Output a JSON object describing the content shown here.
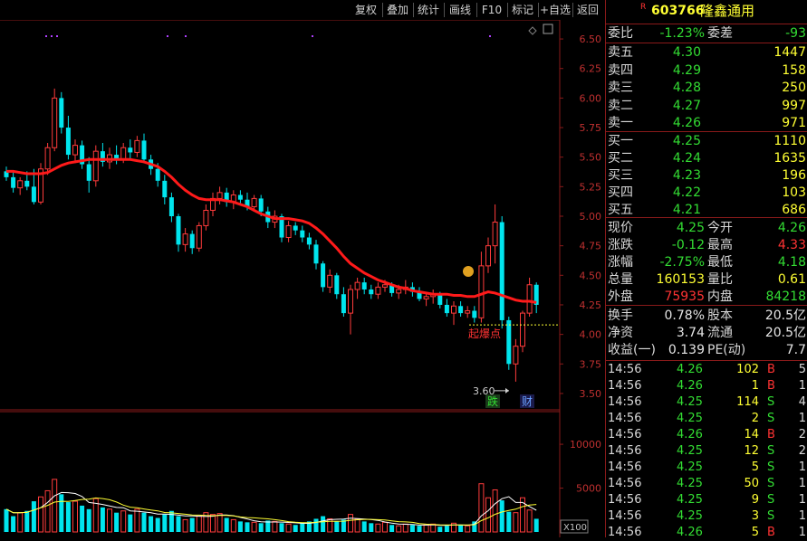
{
  "toolbar": {
    "buttons": [
      "复权",
      "叠加",
      "统计",
      "画线",
      "F10",
      "标记",
      "+自选",
      "返回"
    ]
  },
  "stock": {
    "marker": "R",
    "code": "603766",
    "name": "隆鑫通用"
  },
  "quote_summary": [
    {
      "label": "委比",
      "value": "-1.23%",
      "label2": "委差",
      "value2": "-93"
    }
  ],
  "sell_orders": [
    {
      "label": "卖五",
      "price": "4.30",
      "volume": "1447"
    },
    {
      "label": "卖四",
      "price": "4.29",
      "volume": "158"
    },
    {
      "label": "卖三",
      "price": "4.28",
      "volume": "250"
    },
    {
      "label": "卖二",
      "price": "4.27",
      "volume": "997"
    },
    {
      "label": "卖一",
      "price": "4.26",
      "volume": "971"
    }
  ],
  "buy_orders": [
    {
      "label": "买一",
      "price": "4.25",
      "volume": "1110"
    },
    {
      "label": "买二",
      "price": "4.24",
      "volume": "1635"
    },
    {
      "label": "买三",
      "price": "4.23",
      "volume": "196"
    },
    {
      "label": "买四",
      "price": "4.22",
      "volume": "103"
    },
    {
      "label": "买五",
      "price": "4.21",
      "volume": "686"
    }
  ],
  "stats": [
    {
      "label": "现价",
      "value": "4.25",
      "label2": "今开",
      "value2": "4.26"
    },
    {
      "label": "涨跌",
      "value": "-0.12",
      "label2": "最高",
      "value2": "4.33"
    },
    {
      "label": "涨幅",
      "value": "-2.75%",
      "label2": "最低",
      "value2": "4.18"
    },
    {
      "label": "总量",
      "value": "160153",
      "label2": "量比",
      "value2": "0.61"
    },
    {
      "label": "外盘",
      "value": "75935",
      "label2": "内盘",
      "value2": "84218"
    }
  ],
  "fundamentals": [
    {
      "label": "换手",
      "value": "0.78%",
      "label2": "股本",
      "value2": "20.5亿"
    },
    {
      "label": "净资",
      "value": "3.74",
      "label2": "流通",
      "value2": "20.5亿"
    },
    {
      "label": "收益(一)",
      "value": "0.139",
      "label2": "PE(动)",
      "value2": "7.7"
    }
  ],
  "ticks": [
    {
      "time": "14:56",
      "price": "4.26",
      "volume": "102",
      "side": "B",
      "count": "5"
    },
    {
      "time": "14:56",
      "price": "4.26",
      "volume": "1",
      "side": "B",
      "count": "1"
    },
    {
      "time": "14:56",
      "price": "4.25",
      "volume": "114",
      "side": "S",
      "count": "4"
    },
    {
      "time": "14:56",
      "price": "4.25",
      "volume": "2",
      "side": "S",
      "count": "1"
    },
    {
      "time": "14:56",
      "price": "4.26",
      "volume": "14",
      "side": "B",
      "count": "2"
    },
    {
      "time": "14:56",
      "price": "4.25",
      "volume": "12",
      "side": "S",
      "count": "2"
    },
    {
      "time": "14:56",
      "price": "4.25",
      "volume": "5",
      "side": "S",
      "count": "1"
    },
    {
      "time": "14:56",
      "price": "4.25",
      "volume": "50",
      "side": "S",
      "count": "1"
    },
    {
      "time": "14:56",
      "price": "4.25",
      "volume": "9",
      "side": "S",
      "count": "1"
    },
    {
      "time": "14:56",
      "price": "4.25",
      "volume": "3",
      "side": "S",
      "count": "1"
    },
    {
      "time": "14:56",
      "price": "4.26",
      "volume": "5",
      "side": "B",
      "count": "1"
    }
  ],
  "chart_data": {
    "type": "candlestick",
    "price_axis_ticks": [
      "6.50",
      "6.25",
      "6.00",
      "5.75",
      "5.50",
      "5.25",
      "5.00",
      "4.75",
      "4.50",
      "4.25",
      "4.00",
      "3.75",
      "3.50"
    ],
    "price_range": [
      3.4,
      6.6
    ],
    "volume_axis_ticks": [
      "10000",
      "5000"
    ],
    "volume_unit": "X100",
    "volume_range": [
      0,
      13000
    ],
    "annotations": {
      "breakout_label": "起爆点",
      "breakout_price": 4.08,
      "low_label": "3.60",
      "low_price": 3.6,
      "badge_fall": "跌",
      "badge_finance": "财"
    },
    "candles": [
      [
        5.38,
        5.42,
        5.3,
        5.33
      ],
      [
        5.33,
        5.38,
        5.2,
        5.24
      ],
      [
        5.24,
        5.33,
        5.18,
        5.3
      ],
      [
        5.3,
        5.38,
        5.22,
        5.25
      ],
      [
        5.25,
        5.4,
        5.1,
        5.12
      ],
      [
        5.12,
        5.45,
        5.1,
        5.4
      ],
      [
        5.4,
        5.62,
        5.35,
        5.58
      ],
      [
        5.58,
        6.08,
        5.55,
        6.0
      ],
      [
        6.0,
        6.05,
        5.7,
        5.75
      ],
      [
        5.75,
        5.85,
        5.48,
        5.52
      ],
      [
        5.52,
        5.65,
        5.45,
        5.6
      ],
      [
        5.6,
        5.64,
        5.4,
        5.44
      ],
      [
        5.44,
        5.5,
        5.2,
        5.3
      ],
      [
        5.3,
        5.6,
        5.25,
        5.55
      ],
      [
        5.55,
        5.62,
        5.42,
        5.46
      ],
      [
        5.46,
        5.58,
        5.4,
        5.52
      ],
      [
        5.52,
        5.6,
        5.44,
        5.48
      ],
      [
        5.48,
        5.62,
        5.45,
        5.58
      ],
      [
        5.58,
        5.65,
        5.48,
        5.54
      ],
      [
        5.54,
        5.68,
        5.5,
        5.64
      ],
      [
        5.64,
        5.7,
        5.45,
        5.48
      ],
      [
        5.48,
        5.52,
        5.35,
        5.4
      ],
      [
        5.4,
        5.45,
        5.25,
        5.3
      ],
      [
        5.3,
        5.35,
        5.1,
        5.16
      ],
      [
        5.16,
        5.2,
        4.95,
        5.0
      ],
      [
        5.0,
        5.02,
        4.7,
        4.76
      ],
      [
        4.76,
        4.9,
        4.7,
        4.85
      ],
      [
        4.85,
        4.88,
        4.68,
        4.73
      ],
      [
        4.73,
        4.95,
        4.7,
        4.92
      ],
      [
        4.92,
        5.1,
        4.88,
        5.05
      ],
      [
        5.05,
        5.2,
        5.0,
        5.15
      ],
      [
        5.15,
        5.25,
        5.1,
        5.2
      ],
      [
        5.2,
        5.24,
        5.08,
        5.12
      ],
      [
        5.12,
        5.22,
        5.06,
        5.18
      ],
      [
        5.18,
        5.22,
        5.1,
        5.14
      ],
      [
        5.14,
        5.2,
        5.05,
        5.08
      ],
      [
        5.08,
        5.18,
        5.04,
        5.15
      ],
      [
        5.15,
        5.18,
        5.0,
        5.04
      ],
      [
        5.04,
        5.08,
        4.9,
        4.95
      ],
      [
        4.95,
        5.05,
        4.9,
        5.0
      ],
      [
        5.0,
        5.02,
        4.78,
        4.82
      ],
      [
        4.82,
        4.96,
        4.78,
        4.92
      ],
      [
        4.92,
        4.95,
        4.84,
        4.88
      ],
      [
        4.88,
        4.92,
        4.78,
        4.82
      ],
      [
        4.82,
        4.86,
        4.72,
        4.76
      ],
      [
        4.76,
        4.8,
        4.55,
        4.6
      ],
      [
        4.6,
        4.62,
        4.36,
        4.4
      ],
      [
        4.4,
        4.55,
        4.35,
        4.5
      ],
      [
        4.5,
        4.52,
        4.3,
        4.34
      ],
      [
        4.34,
        4.4,
        4.15,
        4.18
      ],
      [
        4.18,
        4.42,
        4.0,
        4.38
      ],
      [
        4.38,
        4.48,
        4.3,
        4.44
      ],
      [
        4.44,
        4.48,
        4.34,
        4.38
      ],
      [
        4.38,
        4.42,
        4.3,
        4.34
      ],
      [
        4.34,
        4.44,
        4.3,
        4.4
      ],
      [
        4.4,
        4.46,
        4.36,
        4.42
      ],
      [
        4.42,
        4.44,
        4.32,
        4.35
      ],
      [
        4.35,
        4.42,
        4.3,
        4.38
      ],
      [
        4.38,
        4.46,
        4.34,
        4.4
      ],
      [
        4.4,
        4.44,
        4.32,
        4.36
      ],
      [
        4.36,
        4.4,
        4.28,
        4.3
      ],
      [
        4.3,
        4.36,
        4.24,
        4.32
      ],
      [
        4.32,
        4.38,
        4.26,
        4.34
      ],
      [
        4.34,
        4.36,
        4.22,
        4.25
      ],
      [
        4.25,
        4.3,
        4.15,
        4.18
      ],
      [
        4.18,
        4.28,
        4.08,
        4.24
      ],
      [
        4.24,
        4.28,
        4.15,
        4.18
      ],
      [
        4.18,
        4.24,
        4.14,
        4.2
      ],
      [
        4.2,
        4.24,
        4.1,
        4.14
      ],
      [
        4.14,
        4.7,
        4.1,
        4.58
      ],
      [
        4.58,
        4.82,
        4.52,
        4.75
      ],
      [
        4.75,
        5.1,
        4.6,
        4.95
      ],
      [
        4.95,
        5.0,
        4.05,
        4.12
      ],
      [
        4.12,
        4.15,
        3.7,
        3.75
      ],
      [
        3.75,
        3.96,
        3.6,
        3.9
      ],
      [
        3.9,
        4.2,
        3.85,
        4.18
      ],
      [
        4.18,
        4.48,
        4.15,
        4.42
      ],
      [
        4.42,
        4.44,
        4.18,
        4.25
      ]
    ],
    "volumes": [
      2600,
      1800,
      2200,
      2400,
      3500,
      4000,
      4700,
      6000,
      4300,
      3400,
      3500,
      3000,
      2600,
      3800,
      2800,
      2600,
      2200,
      2400,
      2000,
      2600,
      2200,
      1800,
      1600,
      2000,
      2400,
      1800,
      1400,
      1600,
      1800,
      2200,
      2000,
      2100,
      1600,
      1400,
      1200,
      1100,
      1100,
      1000,
      1300,
      1200,
      1000,
      900,
      800,
      1000,
      1200,
      1500,
      1800,
      1500,
      1200,
      1400,
      2000,
      1500,
      1200,
      1000,
      900,
      1100,
      800,
      700,
      900,
      800,
      700,
      800,
      900,
      600,
      700,
      1000,
      800,
      700,
      1200,
      5500,
      3900,
      4800,
      3600,
      2300,
      2200,
      3900,
      2500,
      1500
    ],
    "ma_line": [
      5.38,
      5.38,
      5.37,
      5.36,
      5.36,
      5.36,
      5.37,
      5.4,
      5.43,
      5.45,
      5.46,
      5.47,
      5.48,
      5.48,
      5.48,
      5.48,
      5.48,
      5.48,
      5.48,
      5.47,
      5.46,
      5.44,
      5.42,
      5.38,
      5.33,
      5.27,
      5.22,
      5.18,
      5.15,
      5.14,
      5.14,
      5.14,
      5.13,
      5.12,
      5.1,
      5.08,
      5.05,
      5.02,
      5.0,
      4.98,
      4.98,
      4.98,
      4.97,
      4.96,
      4.94,
      4.9,
      4.85,
      4.79,
      4.73,
      4.66,
      4.6,
      4.56,
      4.52,
      4.49,
      4.46,
      4.44,
      4.42,
      4.4,
      4.39,
      4.37,
      4.36,
      4.35,
      4.34,
      4.34,
      4.34,
      4.33,
      4.33,
      4.32,
      4.32,
      4.34,
      4.36,
      4.35,
      4.33,
      4.31,
      4.29,
      4.28,
      4.28,
      4.27
    ]
  }
}
